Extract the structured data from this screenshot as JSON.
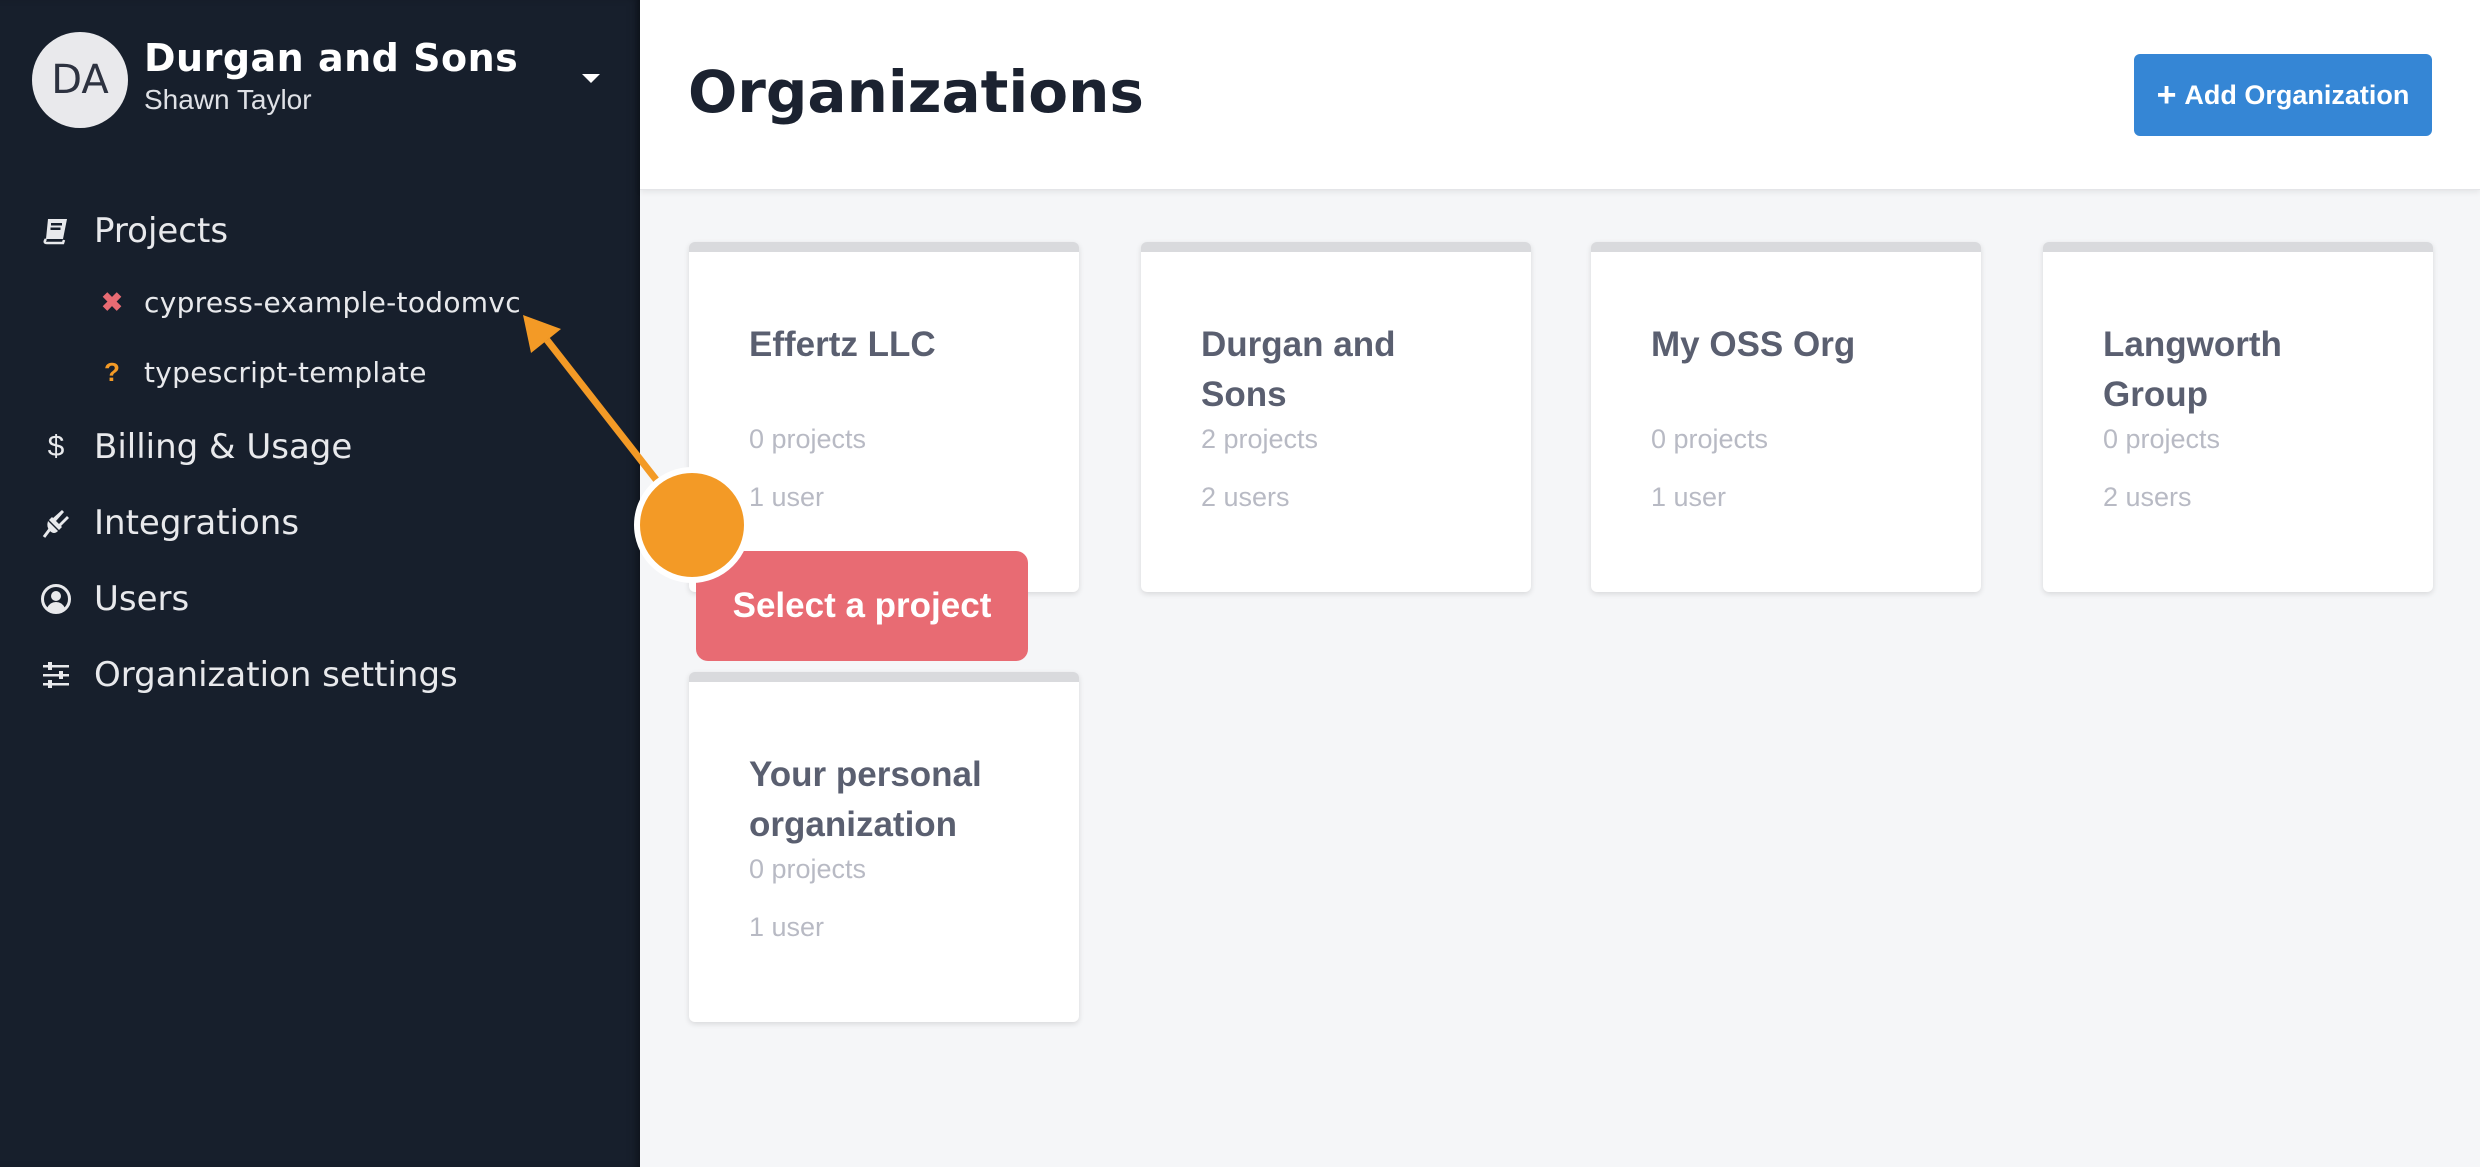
{
  "sidebar": {
    "avatar_initials": "DA",
    "org_name": "Durgan and Sons",
    "user_name": "Shawn Taylor",
    "nav": [
      {
        "label": "Projects",
        "icon": "book-icon"
      },
      {
        "label": "Billing & Usage",
        "icon": "dollar-icon"
      },
      {
        "label": "Integrations",
        "icon": "plug-icon"
      },
      {
        "label": "Users",
        "icon": "user-circle-icon"
      },
      {
        "label": "Organization settings",
        "icon": "sliders-icon"
      }
    ],
    "projects": [
      {
        "label": "cypress-example-todomvc",
        "status_icon": "✖",
        "status": "failed",
        "status_color": "#e86b73"
      },
      {
        "label": "typescript-template",
        "status_icon": "?",
        "status": "unknown",
        "status_color": "#f39a26"
      }
    ],
    "icons": {
      "book": "📕",
      "dollar": "$",
      "plug": "🔌",
      "user": "👤",
      "sliders": "☰"
    }
  },
  "header": {
    "title": "Organizations",
    "add_button_icon": "+",
    "add_button_label": "Add Organization"
  },
  "organizations": [
    {
      "name": "Effertz LLC",
      "projects": "0 projects",
      "users": "1 user"
    },
    {
      "name": "Durgan and Sons",
      "projects": "2 projects",
      "users": "2 users"
    },
    {
      "name": "My OSS Org",
      "projects": "0 projects",
      "users": "1 user"
    },
    {
      "name": "Langworth Group",
      "projects": "0 projects",
      "users": "2 users"
    },
    {
      "name": "Your personal organization",
      "projects": "0 projects",
      "users": "1 user"
    }
  ],
  "annotation": {
    "tooltip_text": "Select a project",
    "accent_color": "#f39a26",
    "tooltip_color": "#e86b73"
  },
  "colors": {
    "sidebar_bg": "#171f2c",
    "primary_button": "#3586d5",
    "page_bg": "#f5f6f8"
  }
}
